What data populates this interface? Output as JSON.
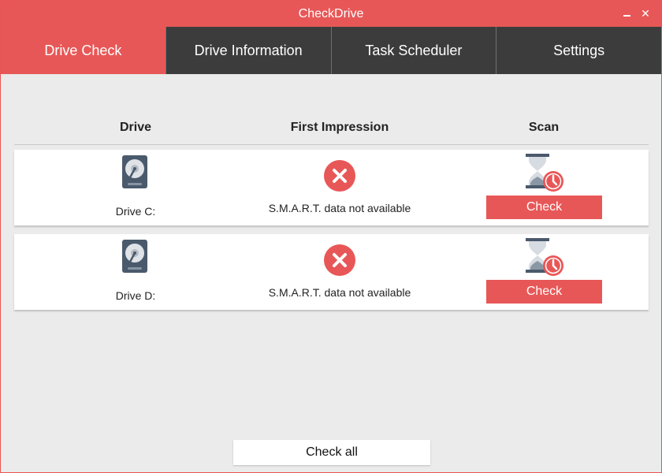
{
  "window": {
    "title": "CheckDrive",
    "minimize_icon": "minimize-icon",
    "close_icon": "close-icon",
    "close_glyph": "✕"
  },
  "tabs": [
    {
      "label": "Drive Check",
      "active": true
    },
    {
      "label": "Drive Information",
      "active": false
    },
    {
      "label": "Task Scheduler",
      "active": false
    },
    {
      "label": "Settings",
      "active": false
    }
  ],
  "table": {
    "headers": {
      "drive": "Drive",
      "impression": "First Impression",
      "scan": "Scan"
    },
    "rows": [
      {
        "drive": "Drive C:",
        "impression": "S.M.A.R.T. data not available",
        "drive_icon": "hard-drive-icon",
        "status_icon": "error-icon",
        "scan_icon": "hourglass-clock-icon",
        "button": "Check"
      },
      {
        "drive": "Drive D:",
        "impression": "S.M.A.R.T. data not available",
        "drive_icon": "hard-drive-icon",
        "status_icon": "error-icon",
        "scan_icon": "hourglass-clock-icon",
        "button": "Check"
      }
    ]
  },
  "footer": {
    "check_all_label": "Check all"
  },
  "colors": {
    "accent": "#e85757",
    "tab_bg": "#3c3c3c",
    "page_bg": "#ebebeb",
    "drive_icon": "#4a5a6c"
  }
}
